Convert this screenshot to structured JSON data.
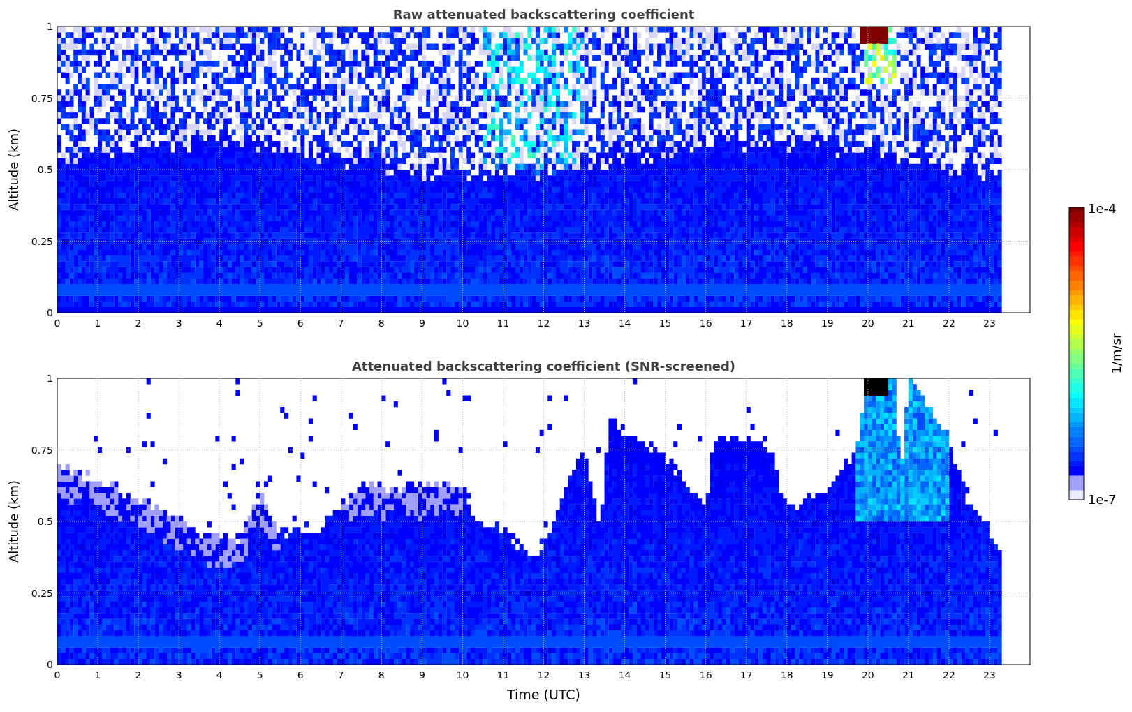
{
  "panels": [
    {
      "kind": "raw",
      "title": "Raw attenuated backscattering coefficient",
      "ylabel": "Altitude (km)",
      "yticks": [
        "1",
        "0.75",
        "0.5",
        "0.25",
        "0"
      ],
      "xticks": [
        "0",
        "1",
        "2",
        "3",
        "4",
        "5",
        "6",
        "7",
        "8",
        "9",
        "10",
        "11",
        "12",
        "13",
        "14",
        "15",
        "16",
        "17",
        "18",
        "19",
        "20",
        "21",
        "22",
        "23"
      ]
    },
    {
      "kind": "screened",
      "title": "Attenuated backscattering coefficient (SNR-screened)",
      "ylabel": "Altitude (km)",
      "yticks": [
        "1",
        "0.75",
        "0.5",
        "0.25",
        "0"
      ],
      "xticks": [
        "0",
        "1",
        "2",
        "3",
        "4",
        "5",
        "6",
        "7",
        "8",
        "9",
        "10",
        "11",
        "12",
        "13",
        "14",
        "15",
        "16",
        "17",
        "18",
        "19",
        "20",
        "21",
        "22",
        "23"
      ],
      "xlabel": "Time (UTC)"
    }
  ],
  "colorbar": {
    "label": "1/m/sr",
    "max": "1e-4",
    "min": "1e-7"
  }
}
